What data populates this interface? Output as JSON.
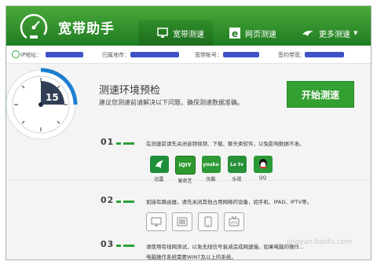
{
  "app": {
    "title": "宽带助手"
  },
  "tabs": [
    {
      "label": "宽带测速",
      "icon": "monitor-icon"
    },
    {
      "label": "网页测速",
      "icon": "browser-e-icon"
    },
    {
      "label": "更多测速",
      "icon": "bird-icon"
    }
  ],
  "info": {
    "ip_label": "IP地址：",
    "region_label": "归属地市：",
    "account_label": "宽带帐号：",
    "bandwidth_label": "签约带宽："
  },
  "diagnostic": {
    "dial_value": "15",
    "title": "测速环境预检",
    "description": "建议您测速前请解决以下问题，确保测速数据准确。",
    "start_button": "开始测速"
  },
  "steps": [
    {
      "number": "01",
      "text": "在测速前请先关闭音频视频、下载、聊天类软件，以免影响数据不准。"
    },
    {
      "number": "02",
      "text": "如接有路由器，请先关闭其他占用网络的设备，如手机、IPAD、IPTV等。"
    },
    {
      "number": "03",
      "text": "请使用有线网测试，以免无线信号衰减造成网速慢。如果电脑的操作系统较低...电脑操作系统需要WIN7及以上的系统。",
      "line1": "请使用有线网测试，以免无线信号衰减造成网速慢。如果电脑的操作...",
      "line2": "电脑操作系统需要WIN7及以上的系统。"
    }
  ],
  "apps": [
    {
      "name": "迅雷",
      "icon": "xunlei-icon",
      "color": "#1f8f3a",
      "glyph": "🐦"
    },
    {
      "name": "爱奇艺",
      "icon": "iqiyi-icon",
      "color": "#2e9a2e",
      "glyph": "iQIY"
    },
    {
      "name": "优酷",
      "icon": "youku-icon",
      "color": "#2d9a35",
      "glyph": "youku"
    },
    {
      "name": "乐视",
      "icon": "letv-icon",
      "color": "#27913a",
      "glyph": "Le tv"
    },
    {
      "name": "QQ",
      "icon": "qq-icon",
      "color": "#2b9a36",
      "glyph": "QQ"
    }
  ],
  "devices": [
    {
      "icon": "monitor-icon"
    },
    {
      "icon": "tablet-icon"
    },
    {
      "icon": "phone-icon"
    },
    {
      "icon": "iptv-icon"
    }
  ],
  "watermark": "jingyan.baidu.com"
}
